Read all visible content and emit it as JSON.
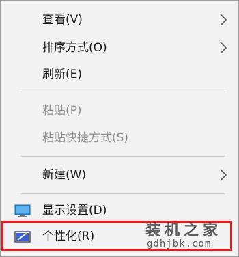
{
  "menu": {
    "items": [
      {
        "label": "查看(V)",
        "submenu": true,
        "disabled": false
      },
      {
        "label": "排序方式(O)",
        "submenu": true,
        "disabled": false
      },
      {
        "label": "刷新(E)",
        "submenu": false,
        "disabled": false
      },
      {
        "label": "粘贴(P)",
        "submenu": false,
        "disabled": true
      },
      {
        "label": "粘贴快捷方式(S)",
        "submenu": false,
        "disabled": true
      },
      {
        "label": "新建(W)",
        "submenu": true,
        "disabled": false
      },
      {
        "label": "显示设置(D)",
        "submenu": false,
        "disabled": false,
        "icon": "display-settings-icon"
      },
      {
        "label": "个性化(R)",
        "submenu": false,
        "disabled": false,
        "icon": "personalize-icon",
        "highlighted": true
      }
    ]
  },
  "watermark": {
    "title": "装机之家",
    "url": "gdhjbk.com"
  },
  "colors": {
    "menu_bg": "#f2f2f2",
    "highlight_border": "#e02020",
    "disabled_text": "#8f8f8f"
  }
}
